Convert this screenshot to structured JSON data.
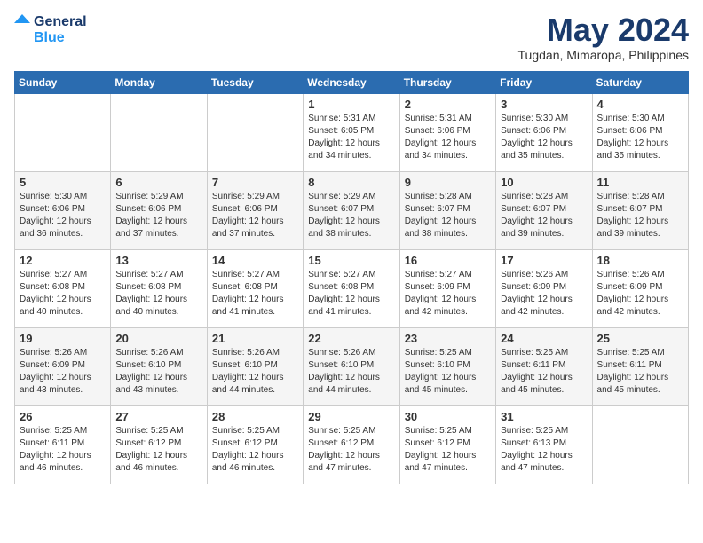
{
  "header": {
    "logo_line1": "General",
    "logo_line2": "Blue",
    "title": "May 2024",
    "subtitle": "Tugdan, Mimaropa, Philippines"
  },
  "days_of_week": [
    "Sunday",
    "Monday",
    "Tuesday",
    "Wednesday",
    "Thursday",
    "Friday",
    "Saturday"
  ],
  "weeks": [
    [
      {
        "day": "",
        "info": ""
      },
      {
        "day": "",
        "info": ""
      },
      {
        "day": "",
        "info": ""
      },
      {
        "day": "1",
        "info": "Sunrise: 5:31 AM\nSunset: 6:05 PM\nDaylight: 12 hours\nand 34 minutes."
      },
      {
        "day": "2",
        "info": "Sunrise: 5:31 AM\nSunset: 6:06 PM\nDaylight: 12 hours\nand 34 minutes."
      },
      {
        "day": "3",
        "info": "Sunrise: 5:30 AM\nSunset: 6:06 PM\nDaylight: 12 hours\nand 35 minutes."
      },
      {
        "day": "4",
        "info": "Sunrise: 5:30 AM\nSunset: 6:06 PM\nDaylight: 12 hours\nand 35 minutes."
      }
    ],
    [
      {
        "day": "5",
        "info": "Sunrise: 5:30 AM\nSunset: 6:06 PM\nDaylight: 12 hours\nand 36 minutes."
      },
      {
        "day": "6",
        "info": "Sunrise: 5:29 AM\nSunset: 6:06 PM\nDaylight: 12 hours\nand 37 minutes."
      },
      {
        "day": "7",
        "info": "Sunrise: 5:29 AM\nSunset: 6:06 PM\nDaylight: 12 hours\nand 37 minutes."
      },
      {
        "day": "8",
        "info": "Sunrise: 5:29 AM\nSunset: 6:07 PM\nDaylight: 12 hours\nand 38 minutes."
      },
      {
        "day": "9",
        "info": "Sunrise: 5:28 AM\nSunset: 6:07 PM\nDaylight: 12 hours\nand 38 minutes."
      },
      {
        "day": "10",
        "info": "Sunrise: 5:28 AM\nSunset: 6:07 PM\nDaylight: 12 hours\nand 39 minutes."
      },
      {
        "day": "11",
        "info": "Sunrise: 5:28 AM\nSunset: 6:07 PM\nDaylight: 12 hours\nand 39 minutes."
      }
    ],
    [
      {
        "day": "12",
        "info": "Sunrise: 5:27 AM\nSunset: 6:08 PM\nDaylight: 12 hours\nand 40 minutes."
      },
      {
        "day": "13",
        "info": "Sunrise: 5:27 AM\nSunset: 6:08 PM\nDaylight: 12 hours\nand 40 minutes."
      },
      {
        "day": "14",
        "info": "Sunrise: 5:27 AM\nSunset: 6:08 PM\nDaylight: 12 hours\nand 41 minutes."
      },
      {
        "day": "15",
        "info": "Sunrise: 5:27 AM\nSunset: 6:08 PM\nDaylight: 12 hours\nand 41 minutes."
      },
      {
        "day": "16",
        "info": "Sunrise: 5:27 AM\nSunset: 6:09 PM\nDaylight: 12 hours\nand 42 minutes."
      },
      {
        "day": "17",
        "info": "Sunrise: 5:26 AM\nSunset: 6:09 PM\nDaylight: 12 hours\nand 42 minutes."
      },
      {
        "day": "18",
        "info": "Sunrise: 5:26 AM\nSunset: 6:09 PM\nDaylight: 12 hours\nand 42 minutes."
      }
    ],
    [
      {
        "day": "19",
        "info": "Sunrise: 5:26 AM\nSunset: 6:09 PM\nDaylight: 12 hours\nand 43 minutes."
      },
      {
        "day": "20",
        "info": "Sunrise: 5:26 AM\nSunset: 6:10 PM\nDaylight: 12 hours\nand 43 minutes."
      },
      {
        "day": "21",
        "info": "Sunrise: 5:26 AM\nSunset: 6:10 PM\nDaylight: 12 hours\nand 44 minutes."
      },
      {
        "day": "22",
        "info": "Sunrise: 5:26 AM\nSunset: 6:10 PM\nDaylight: 12 hours\nand 44 minutes."
      },
      {
        "day": "23",
        "info": "Sunrise: 5:25 AM\nSunset: 6:10 PM\nDaylight: 12 hours\nand 45 minutes."
      },
      {
        "day": "24",
        "info": "Sunrise: 5:25 AM\nSunset: 6:11 PM\nDaylight: 12 hours\nand 45 minutes."
      },
      {
        "day": "25",
        "info": "Sunrise: 5:25 AM\nSunset: 6:11 PM\nDaylight: 12 hours\nand 45 minutes."
      }
    ],
    [
      {
        "day": "26",
        "info": "Sunrise: 5:25 AM\nSunset: 6:11 PM\nDaylight: 12 hours\nand 46 minutes."
      },
      {
        "day": "27",
        "info": "Sunrise: 5:25 AM\nSunset: 6:12 PM\nDaylight: 12 hours\nand 46 minutes."
      },
      {
        "day": "28",
        "info": "Sunrise: 5:25 AM\nSunset: 6:12 PM\nDaylight: 12 hours\nand 46 minutes."
      },
      {
        "day": "29",
        "info": "Sunrise: 5:25 AM\nSunset: 6:12 PM\nDaylight: 12 hours\nand 47 minutes."
      },
      {
        "day": "30",
        "info": "Sunrise: 5:25 AM\nSunset: 6:12 PM\nDaylight: 12 hours\nand 47 minutes."
      },
      {
        "day": "31",
        "info": "Sunrise: 5:25 AM\nSunset: 6:13 PM\nDaylight: 12 hours\nand 47 minutes."
      },
      {
        "day": "",
        "info": ""
      }
    ]
  ]
}
